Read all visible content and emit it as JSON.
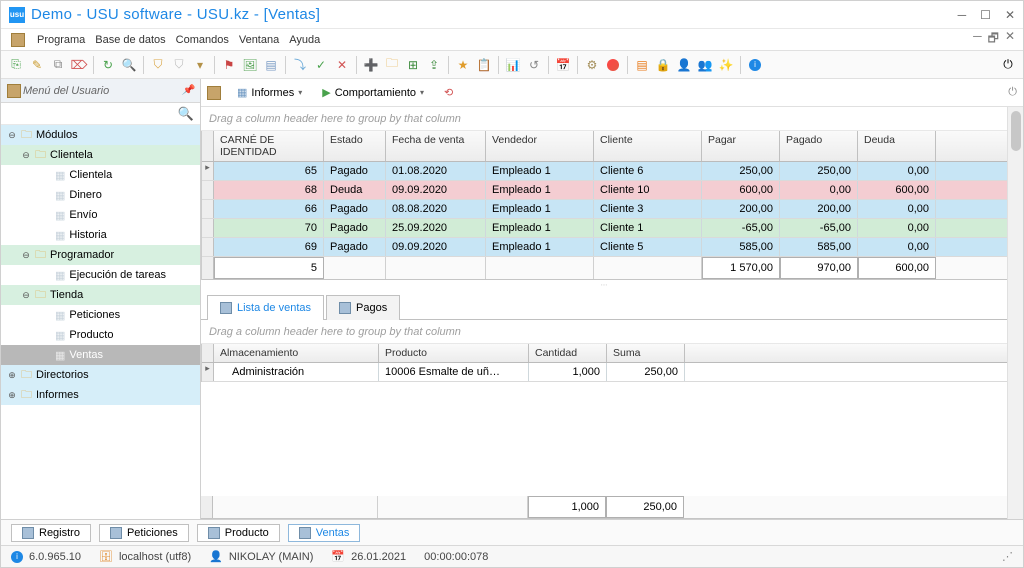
{
  "title": "Demo - USU software - USU.kz - [Ventas]",
  "logo_text": "usu",
  "menu": {
    "items": [
      "Programa",
      "Base de datos",
      "Comandos",
      "Ventana",
      "Ayuda"
    ]
  },
  "sidebar": {
    "header": "Menú del Usuario",
    "nodes": {
      "modulos": "Módulos",
      "clientela": "Clientela",
      "clientela_sub": "Clientela",
      "dinero": "Dinero",
      "envio": "Envío",
      "historia": "Historia",
      "programador": "Programador",
      "ejecucion": "Ejecución de tareas",
      "tienda": "Tienda",
      "peticiones": "Peticiones",
      "producto": "Producto",
      "ventas": "Ventas",
      "directorios": "Directorios",
      "informes": "Informes"
    }
  },
  "subtoolbar": {
    "informes": "Informes",
    "comportamiento": "Comportamiento"
  },
  "group_hint": "Drag a column header here to group by that column",
  "grid": {
    "headers": {
      "id": "CARNÉ DE IDENTIDAD",
      "estado": "Estado",
      "fecha": "Fecha de venta",
      "vendedor": "Vendedor",
      "cliente": "Cliente",
      "pagar": "Pagar",
      "pagado": "Pagado",
      "deuda": "Deuda"
    },
    "rows": [
      {
        "id": "65",
        "estado": "Pagado",
        "fecha": "01.08.2020",
        "vendedor": "Empleado 1",
        "cliente": "Cliente 6",
        "pagar": "250,00",
        "pagado": "250,00",
        "deuda": "0,00",
        "cls": "c-blue",
        "caret": true
      },
      {
        "id": "68",
        "estado": "Deuda",
        "fecha": "09.09.2020",
        "vendedor": "Empleado 1",
        "cliente": "Cliente 10",
        "pagar": "600,00",
        "pagado": "0,00",
        "deuda": "600,00",
        "cls": "c-pink"
      },
      {
        "id": "66",
        "estado": "Pagado",
        "fecha": "08.08.2020",
        "vendedor": "Empleado 1",
        "cliente": "Cliente 3",
        "pagar": "200,00",
        "pagado": "200,00",
        "deuda": "0,00",
        "cls": "c-blue"
      },
      {
        "id": "70",
        "estado": "Pagado",
        "fecha": "25.09.2020",
        "vendedor": "Empleado 1",
        "cliente": "Cliente 1",
        "pagar": "-65,00",
        "pagado": "-65,00",
        "deuda": "0,00",
        "cls": "c-green"
      },
      {
        "id": "69",
        "estado": "Pagado",
        "fecha": "09.09.2020",
        "vendedor": "Empleado 1",
        "cliente": "Cliente 5",
        "pagar": "585,00",
        "pagado": "585,00",
        "deuda": "0,00",
        "cls": "c-blue"
      }
    ],
    "footer": {
      "id": "5",
      "pagar": "1 570,00",
      "pagado": "970,00",
      "deuda": "600,00"
    }
  },
  "detail_tabs": {
    "lista": "Lista de ventas",
    "pagos": "Pagos"
  },
  "detail_grid": {
    "headers": {
      "store": "Almacenamiento",
      "product": "Producto",
      "qty": "Cantidad",
      "sum": "Suma"
    },
    "row": {
      "store": "Administración",
      "product": "10006 Esmalte de uñ…",
      "qty": "1,000",
      "sum": "250,00"
    },
    "footer": {
      "qty": "1,000",
      "sum": "250,00"
    }
  },
  "bottom_tabs": {
    "registro": "Registro",
    "peticiones": "Peticiones",
    "producto": "Producto",
    "ventas": "Ventas"
  },
  "status": {
    "version": "6.0.965.10",
    "host": "localhost (utf8)",
    "user": "NIKOLAY (MAIN)",
    "date": "26.01.2021",
    "time": "00:00:00:078"
  }
}
